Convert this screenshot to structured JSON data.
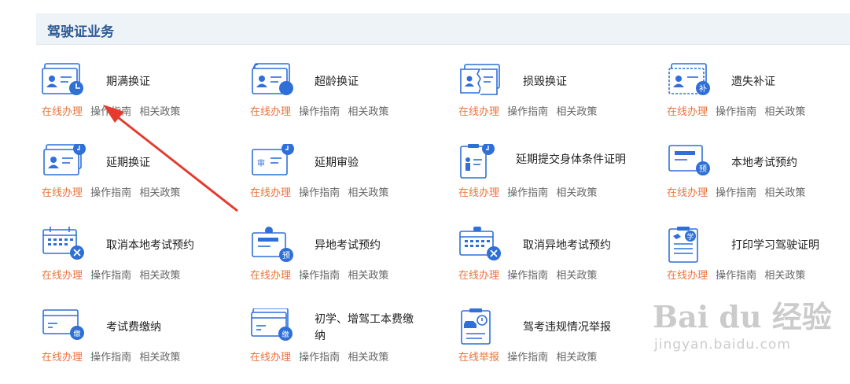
{
  "section": {
    "title": "驾驶证业务"
  },
  "services": [
    {
      "title": "期满换证",
      "links": [
        "在线办理",
        "操作指南",
        "相关政策"
      ]
    },
    {
      "title": "超龄换证",
      "links": [
        "在线办理",
        "操作指南",
        "相关政策"
      ]
    },
    {
      "title": "损毁换证",
      "links": [
        "在线办理",
        "操作指南",
        "相关政策"
      ]
    },
    {
      "title": "遗失补证",
      "links": [
        "在线办理",
        "操作指南",
        "相关政策"
      ]
    },
    {
      "title": "延期换证",
      "links": [
        "在线办理",
        "操作指南",
        "相关政策"
      ]
    },
    {
      "title": "延期审验",
      "links": [
        "在线办理",
        "操作指南",
        "相关政策"
      ]
    },
    {
      "title": "延期提交身体条件证明",
      "links": [
        "在线办理",
        "操作指南",
        "相关政策"
      ]
    },
    {
      "title": "本地考试预约",
      "links": [
        "在线办理",
        "操作指南",
        "相关政策"
      ]
    },
    {
      "title": "取消本地考试预约",
      "links": [
        "在线办理",
        "操作指南",
        "相关政策"
      ]
    },
    {
      "title": "异地考试预约",
      "links": [
        "在线办理",
        "操作指南",
        "相关政策"
      ]
    },
    {
      "title": "取消异地考试预约",
      "links": [
        "在线办理",
        "操作指南",
        "相关政策"
      ]
    },
    {
      "title": "打印学习驾驶证明",
      "links": [
        "在线办理",
        "操作指南",
        "相关政策"
      ]
    },
    {
      "title": "考试费缴纳",
      "links": [
        "在线办理",
        "操作指南",
        "相关政策"
      ]
    },
    {
      "title": "初学、增驾工本费缴纳",
      "links": [
        "在线办理",
        "操作指南",
        "相关政策"
      ]
    },
    {
      "title": "驾考违规情况举报",
      "links": [
        "在线举报",
        "操作指南",
        "相关政策"
      ]
    }
  ],
  "icon_badges": {
    "lost": "补",
    "exam": "预",
    "study": "学",
    "fee": "缴",
    "review": "审"
  },
  "watermark": {
    "logo": "Bai du 经验",
    "url": "jingyan.baidu.com"
  },
  "colors": {
    "accent_orange": "#e8743b",
    "icon_blue": "#2f6fd8",
    "header_bg": "#eef3f8",
    "header_text": "#2d5a93",
    "arrow": "#e53b2f"
  }
}
